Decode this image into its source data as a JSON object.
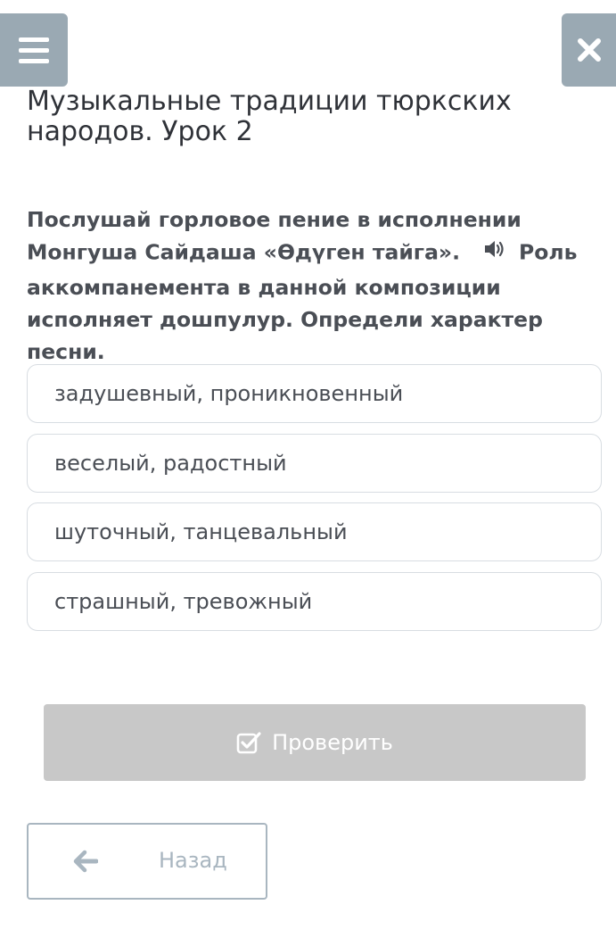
{
  "header": {
    "menu_icon": "hamburger-menu-icon",
    "close_icon": "close-icon",
    "accent_color": "#9aa9b3"
  },
  "lesson": {
    "title": "Музыкальные традиции тюркских народов. Урок 2"
  },
  "question": {
    "text_before_audio": "Послушай горловое пение в исполнении Монгуша Сайдаша «Өдүген тайга».",
    "audio_icon": "speaker-icon",
    "text_after_audio": "Роль аккомпанемента в данной композиции исполняет дошпулур. Определи характер песни."
  },
  "options": [
    {
      "label": "задушевный, проникновенный"
    },
    {
      "label": "веселый, радостный"
    },
    {
      "label": "шуточный, танцевальный"
    },
    {
      "label": "страшный, тревожный"
    }
  ],
  "actions": {
    "check_label": "Проверить",
    "check_icon": "checkbox-check-icon",
    "check_color": "#c8c8c8",
    "back_label": "Назад",
    "back_icon": "arrow-left-icon"
  }
}
